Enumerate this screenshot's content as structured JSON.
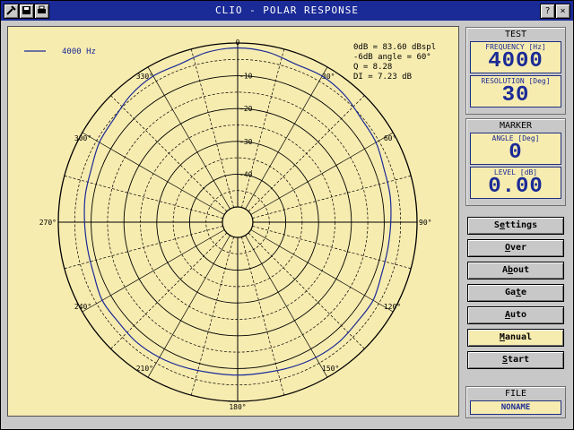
{
  "window": {
    "title": "CLIO - POLAR RESPONSE"
  },
  "titlebar": {
    "help_label": "?",
    "close_label": "×"
  },
  "legend": {
    "label": "4000 Hz"
  },
  "info": {
    "line1": "0dB = 83.60 dBspl",
    "line2": "-6dB angle = 60°",
    "line3": "Q = 8.28",
    "line4": "DI = 7.23 dB"
  },
  "polar": {
    "angle_labels": [
      {
        "deg": 0,
        "text": "0"
      },
      {
        "deg": 30,
        "text": "30°"
      },
      {
        "deg": 60,
        "text": "60°"
      },
      {
        "deg": 90,
        "text": "90°"
      },
      {
        "deg": 120,
        "text": "120°"
      },
      {
        "deg": 150,
        "text": "150°"
      },
      {
        "deg": 180,
        "text": "180°"
      },
      {
        "deg": 210,
        "text": "210°"
      },
      {
        "deg": 240,
        "text": "240°"
      },
      {
        "deg": 270,
        "text": "270°"
      },
      {
        "deg": 300,
        "text": "300°"
      },
      {
        "deg": 330,
        "text": "330°"
      }
    ],
    "ring_labels": [
      "-10",
      "-20",
      "-30",
      "-40"
    ],
    "range_db": [
      -50,
      0
    ],
    "trace_color": "#1a2a96",
    "response": [
      {
        "deg": 0,
        "db": -1.5
      },
      {
        "deg": 10,
        "db": -2.0
      },
      {
        "deg": 20,
        "db": -3.3
      },
      {
        "deg": 30,
        "db": -3.2
      },
      {
        "deg": 40,
        "db": -4.0
      },
      {
        "deg": 50,
        "db": -5.5
      },
      {
        "deg": 60,
        "db": -6.0
      },
      {
        "deg": 70,
        "db": -7.2
      },
      {
        "deg": 80,
        "db": -7.5
      },
      {
        "deg": 90,
        "db": -8.0
      },
      {
        "deg": 100,
        "db": -8.2
      },
      {
        "deg": 110,
        "db": -8.0
      },
      {
        "deg": 120,
        "db": -7.0
      },
      {
        "deg": 130,
        "db": -7.2
      },
      {
        "deg": 140,
        "db": -6.8
      },
      {
        "deg": 150,
        "db": -7.0
      },
      {
        "deg": 160,
        "db": -7.5
      },
      {
        "deg": 170,
        "db": -8.0
      },
      {
        "deg": 180,
        "db": -8.0
      },
      {
        "deg": 190,
        "db": -8.0
      },
      {
        "deg": 200,
        "db": -7.5
      },
      {
        "deg": 210,
        "db": -7.0
      },
      {
        "deg": 220,
        "db": -6.8
      },
      {
        "deg": 230,
        "db": -7.2
      },
      {
        "deg": 240,
        "db": -7.0
      },
      {
        "deg": 250,
        "db": -8.0
      },
      {
        "deg": 260,
        "db": -8.2
      },
      {
        "deg": 270,
        "db": -8.0
      },
      {
        "deg": 280,
        "db": -7.5
      },
      {
        "deg": 290,
        "db": -7.2
      },
      {
        "deg": 300,
        "db": -6.0
      },
      {
        "deg": 310,
        "db": -5.5
      },
      {
        "deg": 320,
        "db": -4.0
      },
      {
        "deg": 330,
        "db": -3.2
      },
      {
        "deg": 340,
        "db": -3.3
      },
      {
        "deg": 350,
        "db": -2.0
      }
    ]
  },
  "test_panel": {
    "title": "TEST",
    "frequency_label": "FREQUENCY [Hz]",
    "frequency_value": "4000",
    "resolution_label": "RESOLUTION [Deg]",
    "resolution_value": "30"
  },
  "marker_panel": {
    "title": "MARKER",
    "angle_label": "ANGLE [Deg]",
    "angle_value": "0",
    "level_label": "LEVEL [dB]",
    "level_value": "0.00"
  },
  "buttons": {
    "settings": {
      "pre": "S",
      "u": "e",
      "post": "ttings"
    },
    "over": {
      "pre": "",
      "u": "O",
      "post": "ver"
    },
    "about": {
      "pre": "A",
      "u": "b",
      "post": "out"
    },
    "gate": {
      "pre": "Ga",
      "u": "t",
      "post": "e"
    },
    "auto": {
      "pre": "",
      "u": "A",
      "post": "uto"
    },
    "manual": {
      "pre": "",
      "u": "M",
      "post": "anual"
    },
    "start": {
      "pre": "",
      "u": "S",
      "post": "tart"
    }
  },
  "file_panel": {
    "title": "FILE",
    "value": "NONAME"
  },
  "colors": {
    "plot_bg": "#f7ecb0",
    "title_bg": "#1a2a96",
    "accent": "#1a2a96"
  }
}
